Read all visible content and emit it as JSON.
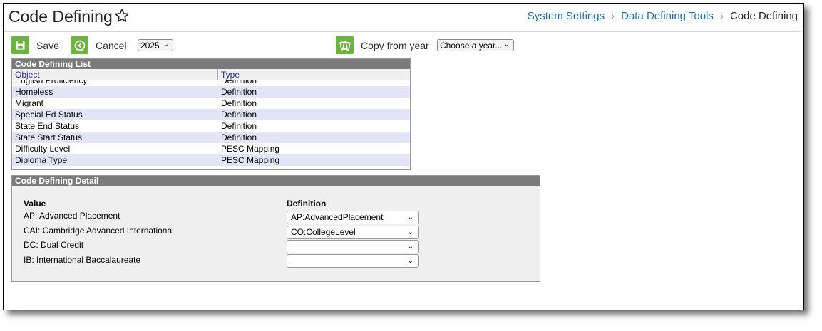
{
  "header": {
    "title": "Code Defining",
    "breadcrumb": [
      "System Settings",
      "Data Defining Tools",
      "Code Defining"
    ]
  },
  "toolbar": {
    "save_label": "Save",
    "cancel_label": "Cancel",
    "year_value": "2025",
    "copy_label": "Copy from year",
    "copy_select_value": "Choose a year..."
  },
  "list": {
    "title": "Code Defining List",
    "col_object": "Object",
    "col_type": "Type",
    "rows": [
      {
        "object": "English Proficiency",
        "type": "Definition"
      },
      {
        "object": "Homeless",
        "type": "Definition"
      },
      {
        "object": "Migrant",
        "type": "Definition"
      },
      {
        "object": "Special Ed Status",
        "type": "Definition"
      },
      {
        "object": "State End Status",
        "type": "Definition"
      },
      {
        "object": "State Start Status",
        "type": "Definition"
      },
      {
        "object": "Difficulty Level",
        "type": "PESC Mapping"
      },
      {
        "object": "Diploma Type",
        "type": "PESC Mapping"
      }
    ]
  },
  "detail": {
    "title": "Code Defining Detail",
    "col_value": "Value",
    "col_definition": "Definition",
    "rows": [
      {
        "value": "AP: Advanced Placement",
        "definition": "AP:AdvancedPlacement"
      },
      {
        "value": "CAI: Cambridge Advanced International",
        "definition": "CO:CollegeLevel"
      },
      {
        "value": "DC: Dual Credit",
        "definition": ""
      },
      {
        "value": "IB: International Baccalaureate",
        "definition": ""
      }
    ]
  },
  "colors": {
    "accent": "#6db33f",
    "link": "#1f6ea8",
    "panel_header": "#7a7a7a",
    "row_alt": "#e4e4f8"
  }
}
